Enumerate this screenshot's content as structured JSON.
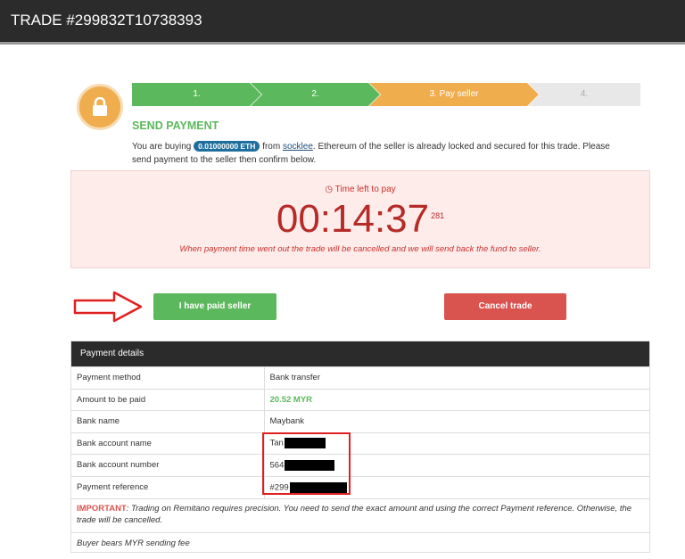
{
  "header": {
    "title": "TRADE #299832T10738393"
  },
  "steps": [
    {
      "label": "1.",
      "state": "done",
      "color": "#5cb85c"
    },
    {
      "label": "2.",
      "state": "done",
      "color": "#5cb85c"
    },
    {
      "label": "3. Pay seller",
      "state": "active",
      "color": "#f0ad4e"
    },
    {
      "label": "4.",
      "state": "pending",
      "color": "#e8e8e8"
    }
  ],
  "section": {
    "title": "SEND PAYMENT",
    "desc_prefix": "You are buying",
    "amount_badge": "0.01000000 ETH",
    "desc_from": "from",
    "seller": "socklee",
    "desc_suffix": ". Ethereum of the seller is already locked and secured for this trade. Please send payment to the seller then confirm below."
  },
  "timer": {
    "label": "Time left to pay",
    "value": "00:14:37",
    "sub": "281",
    "note": "When payment time went out the trade will be cancelled and we will send back the fund to seller."
  },
  "actions": {
    "paid": "I have paid seller",
    "cancel": "Cancel trade"
  },
  "payment": {
    "heading": "Payment details",
    "rows": [
      {
        "label": "Payment method",
        "value": "Bank transfer"
      },
      {
        "label": "Amount to be paid",
        "value": "20.52 MYR"
      },
      {
        "label": "Bank name",
        "value": "Maybank"
      },
      {
        "label": "Bank account name",
        "value": "Tan"
      },
      {
        "label": "Bank account number",
        "value": "564"
      },
      {
        "label": "Payment reference",
        "value": "#299"
      }
    ],
    "important_label": "IMPORTANT",
    "important_text": ": Trading on Remitano requires precision. You need to send the exact amount and using the correct Payment reference. Otherwise, the trade will be cancelled.",
    "fee_note": "Buyer bears MYR sending fee"
  },
  "colors": {
    "green": "#5cb85c",
    "orange": "#f0ad4e",
    "red": "#d9534f",
    "dark": "#2b2b2b"
  }
}
